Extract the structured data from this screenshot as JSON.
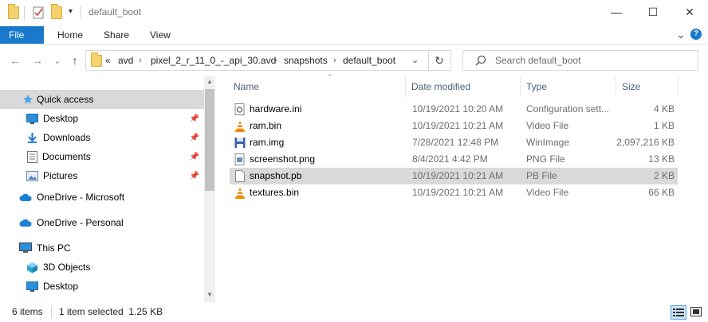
{
  "window": {
    "title": "default_boot",
    "controls": {
      "minimize": "—",
      "maximize": "☐",
      "close": "✕"
    }
  },
  "ribbon": {
    "tabs": [
      "File",
      "Home",
      "Share",
      "View"
    ],
    "expand": "⌄",
    "help": "?"
  },
  "nav": {
    "back": "←",
    "forward": "→",
    "recent": "⌄",
    "up": "↑"
  },
  "address": {
    "overflow": "«",
    "crumbs": [
      "avd",
      "pixel_2_r_11_0_-_api_30.avd",
      "snapshots",
      "default_boot"
    ],
    "dropdown": "⌄",
    "refresh": "↻"
  },
  "search": {
    "placeholder": "Search default_boot"
  },
  "navpane": {
    "items": [
      {
        "label": "Quick access",
        "icon": "star-icon",
        "pinned": false,
        "selected": true
      },
      {
        "label": "Desktop",
        "icon": "desktop-icon",
        "pinned": true
      },
      {
        "label": "Downloads",
        "icon": "download-icon",
        "pinned": true
      },
      {
        "label": "Documents",
        "icon": "documents-icon",
        "pinned": true
      },
      {
        "label": "Pictures",
        "icon": "pictures-icon",
        "pinned": true
      },
      {
        "label": "OneDrive - Microsoft",
        "icon": "cloud-icon"
      },
      {
        "label": "OneDrive - Personal",
        "icon": "cloud-icon"
      },
      {
        "label": "This PC",
        "icon": "computer-icon"
      },
      {
        "label": "3D Objects",
        "icon": "cube-icon"
      },
      {
        "label": "Desktop",
        "icon": "desktop-icon"
      }
    ]
  },
  "columns": {
    "name": "Name",
    "date": "Date modified",
    "type": "Type",
    "size": "Size"
  },
  "files": [
    {
      "name": "hardware.ini",
      "date": "10/19/2021 10:20 AM",
      "type": "Configuration sett...",
      "size": "4 KB",
      "icon": "config-file-icon"
    },
    {
      "name": "ram.bin",
      "date": "10/19/2021 10:21 AM",
      "type": "Video File",
      "size": "1 KB",
      "icon": "vlc-cone-icon"
    },
    {
      "name": "ram.img",
      "date": "7/28/2021 12:48 PM",
      "type": "WinImage",
      "size": "2,097,216 KB",
      "icon": "floppy-disk-icon"
    },
    {
      "name": "screenshot.png",
      "date": "8/4/2021 4:42 PM",
      "type": "PNG File",
      "size": "13 KB",
      "icon": "image-file-icon"
    },
    {
      "name": "snapshot.pb",
      "date": "10/19/2021 10:21 AM",
      "type": "PB File",
      "size": "2 KB",
      "icon": "blank-file-icon",
      "selected": true
    },
    {
      "name": "textures.bin",
      "date": "10/19/2021 10:21 AM",
      "type": "Video File",
      "size": "66 KB",
      "icon": "vlc-cone-icon"
    }
  ],
  "status": {
    "item_count": "6 items",
    "selection": "1 item selected  1.25 KB"
  },
  "colors": {
    "accent": "#1979ca",
    "selection": "#d9d9d9",
    "folder": "#f5d26b"
  }
}
